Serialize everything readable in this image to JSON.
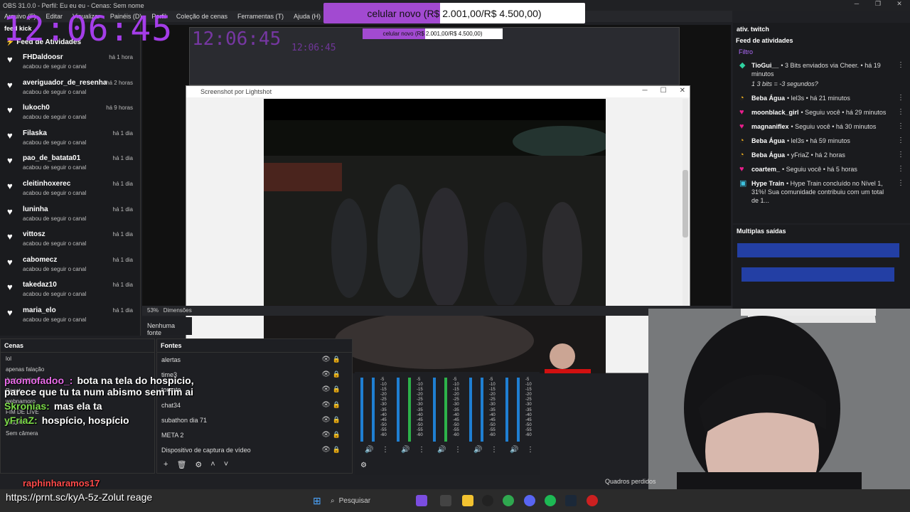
{
  "obs": {
    "title": "OBS 31.0.0 - Perfil: Eu eu eu - Cenas: Sem nome",
    "menu": [
      "Arquivo (F)",
      "Editar",
      "Visualizar",
      "Painéis (D)",
      "Perfil",
      "Coleção de cenas",
      "Ferramentas (T)",
      "Ajuda (H)"
    ],
    "status_zoom": "53%",
    "status_dim": "Dimensões",
    "no_source": "Nenhuma fonte",
    "quadros": "Quadros perdidos"
  },
  "overlay": {
    "clock": "12:06:45",
    "goal_text": "celular novo (R$ 2.001,00/R$ 4.500,00)",
    "goal_progress": 0.445,
    "goal_accent": "#a24ad1"
  },
  "kick_feed": {
    "panel_title": "feed kick",
    "header": "Feed de Atividades",
    "items": [
      {
        "name": "FHDaldoosr",
        "action": "acabou de seguir o canal",
        "time": "há 1 hora"
      },
      {
        "name": "averiguador_de_resenha",
        "action": "acabou de seguir o canal",
        "time": "há 2 horas"
      },
      {
        "name": "lukoch0",
        "action": "acabou de seguir o canal",
        "time": "há 9 horas"
      },
      {
        "name": "Filaska",
        "action": "acabou de seguir o canal",
        "time": "há 1 dia"
      },
      {
        "name": "pao_de_batata01",
        "action": "acabou de seguir o canal",
        "time": "há 1 dia"
      },
      {
        "name": "cleitinhoxerec",
        "action": "acabou de seguir o canal",
        "time": "há 1 dia"
      },
      {
        "name": "luninha",
        "action": "acabou de seguir o canal",
        "time": "há 1 dia"
      },
      {
        "name": "vittosz",
        "action": "acabou de seguir o canal",
        "time": "há 1 dia"
      },
      {
        "name": "cabomecz",
        "action": "acabou de seguir o canal",
        "time": "há 1 dia"
      },
      {
        "name": "takedaz10",
        "action": "acabou de seguir o canal",
        "time": "há 1 dia"
      },
      {
        "name": "maria_elo",
        "action": "acabou de seguir o canal",
        "time": "há 1 dia"
      }
    ]
  },
  "lightshot": {
    "title": "Screenshot por Lightshot"
  },
  "scenes": {
    "title": "Cenas",
    "items": [
      "lol",
      "apenas falação",
      "Just chatting",
      "React",
      "webnamoro",
      "FIM DE LIVE",
      "OSCAR",
      "Sem câmera"
    ]
  },
  "sources": {
    "title": "Fontes",
    "items": [
      "alertas",
      "time3",
      "tomate",
      "chat34",
      "subathon dia 71",
      "META 2",
      "Dispositivo de captura de vídeo"
    ]
  },
  "mixer": {
    "scale": [
      "-5",
      "-10",
      "-15",
      "-20",
      "-25",
      "-30",
      "-35",
      "-40",
      "-45",
      "-50",
      "-55",
      "-60"
    ]
  },
  "chat": [
    {
      "user": "paomofadoo_:",
      "msg": "bota na tela do hospicio, parece que tu ta num abismo sem fim ai",
      "color": "#e86ce8"
    },
    {
      "user": "Skronias:",
      "msg": "mas ela ta",
      "color": "#7ddc4a"
    },
    {
      "user": "yFriaZ:",
      "msg": "hospício, hospício",
      "color": "#7ddc4a"
    }
  ],
  "chat_last_user": "raphinharamos17",
  "bottom_caption": "https://prnt.sc/kyA-5z-Zolut reage",
  "twitch": {
    "panel_title": "ativ. twitch",
    "header": "Feed de atividades",
    "filter": "Filtro",
    "items": [
      {
        "icon": "bits-icon",
        "who": "TioGui__",
        "text": "• 3 Bits enviados via Cheer. • há 19 minutos",
        "extra": "1 3 bits = -3 segundos?"
      },
      {
        "icon": "clock-icon",
        "who": "Beba Água",
        "text": "• lel3s • há 21 minutos",
        "extra": ""
      },
      {
        "icon": "heart-icon",
        "who": "moonblack_girl",
        "text": "• Seguiu você • há 29 minutos",
        "extra": ""
      },
      {
        "icon": "heart-icon",
        "who": "magnaniflex",
        "text": "• Seguiu você • há 30 minutos",
        "extra": ""
      },
      {
        "icon": "clock-icon",
        "who": "Beba Água",
        "text": "• lel3s • há 59 minutos",
        "extra": ""
      },
      {
        "icon": "clock-icon",
        "who": "Beba Água",
        "text": "• yFriaZ • há 2 horas",
        "extra": ""
      },
      {
        "icon": "heart-icon",
        "who": "coartem_",
        "text": "• Seguiu você • há 5 horas",
        "extra": ""
      },
      {
        "icon": "train-icon",
        "who": "Hype Train",
        "text": "• Hype Train concluído no Nível 1, 31%! Sua comunidade contribuiu com um total de 1...",
        "extra": ""
      }
    ]
  },
  "multi": {
    "title": "Multiplas saídas"
  },
  "taskbar": {
    "search": "Pesquisar"
  }
}
